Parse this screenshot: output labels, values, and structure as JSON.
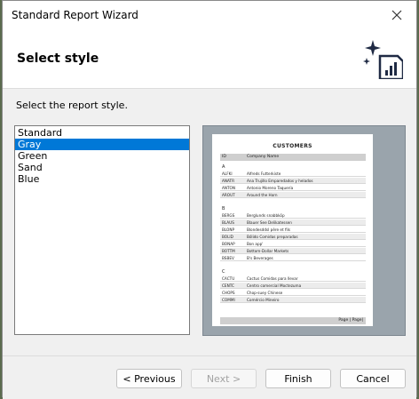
{
  "window": {
    "title": "Standard Report Wizard"
  },
  "header": {
    "heading": "Select style"
  },
  "main": {
    "instruction": "Select the report style.",
    "styles": [
      "Standard",
      "Gray",
      "Green",
      "Sand",
      "Blue"
    ],
    "selected_style": "Gray"
  },
  "preview": {
    "title": "CUSTOMERS",
    "columns": [
      "ID",
      "Company Name"
    ],
    "groups": [
      {
        "letter": "A",
        "rows": [
          [
            "ALFKI",
            "Alfreds Futterkiste"
          ],
          [
            "ANATR",
            "Ana Trujillo Emparedados y helados"
          ],
          [
            "ANTON",
            "Antonio Moreno Taquería"
          ],
          [
            "AROUT",
            "Around the Horn"
          ]
        ]
      },
      {
        "letter": "B",
        "rows": [
          [
            "BERGS",
            "Berglunds snabbköp"
          ],
          [
            "BLAUS",
            "Blauer See Delikatessen"
          ],
          [
            "BLONP",
            "Blondesddsl père et fils"
          ],
          [
            "BOLID",
            "Bólido Comidas preparadas"
          ],
          [
            "BONAP",
            "Bon app'"
          ],
          [
            "BOTTM",
            "Bottom-Dollar Markets"
          ],
          [
            "BSBEV",
            "B's Beverages"
          ]
        ]
      },
      {
        "letter": "C",
        "rows": [
          [
            "CACTU",
            "Cactus Comidas para llevar"
          ],
          [
            "CENTC",
            "Centro comercial Moctezuma"
          ],
          [
            "CHOPS",
            "Chop-suey Chinese"
          ],
          [
            "COMMI",
            "Comércio Mineiro"
          ]
        ]
      }
    ],
    "page_footer": "Page | Page|"
  },
  "buttons": {
    "previous": "< Previous",
    "next": "Next >",
    "finish": "Finish",
    "cancel": "Cancel"
  },
  "colors": {
    "selection": "#0078d7",
    "header_gray": "#cfcfcf",
    "preview_bg": "#9aa4ac"
  }
}
